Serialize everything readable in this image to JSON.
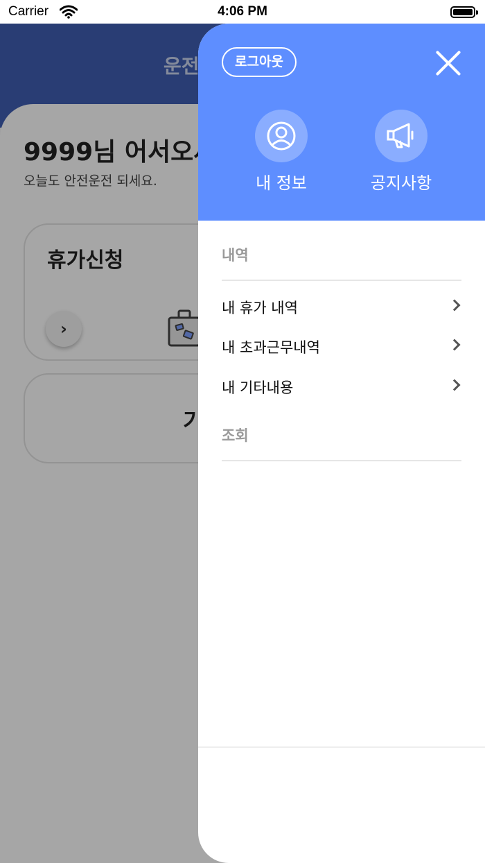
{
  "status_bar": {
    "carrier": "Carrier",
    "time": "4:06 PM"
  },
  "background": {
    "header_title": "운전",
    "greeting": "9999님 어서오세",
    "subtitle": "오늘도 안전운전 되세요.",
    "card1_title": "휴가신청",
    "card1_button": "›",
    "card2_label": "기"
  },
  "drawer": {
    "logout_label": "로그아웃",
    "quick_actions": [
      {
        "label": "내 정보",
        "icon": "user-icon"
      },
      {
        "label": "공지사항",
        "icon": "megaphone-icon"
      }
    ],
    "sections": [
      {
        "title": "내역",
        "items": [
          {
            "label": "내 휴가 내역"
          },
          {
            "label": "내 초과근무내역"
          },
          {
            "label": "내 기타내용"
          }
        ]
      },
      {
        "title": "조회",
        "items": []
      }
    ]
  },
  "colors": {
    "drawer_header": "#5e8eff",
    "app_header": "#3f5fb3",
    "section_title": "#9a9a9a"
  }
}
